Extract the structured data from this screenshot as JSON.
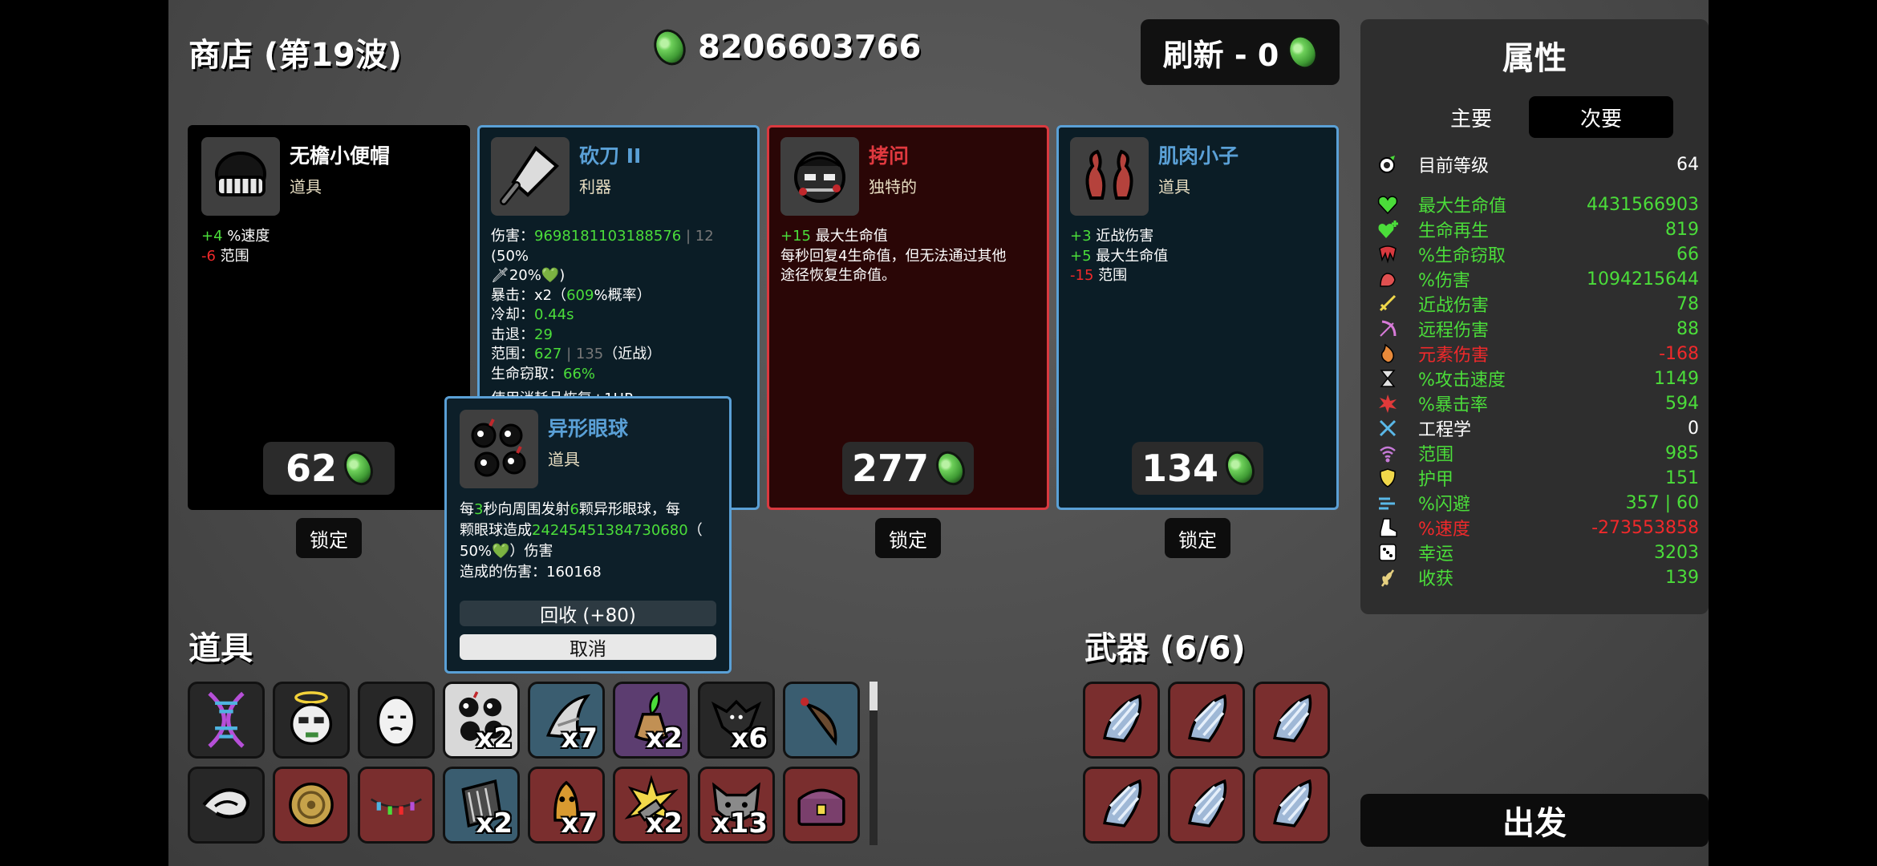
{
  "header": {
    "title": "商店 (第19波)",
    "money": "8206603766",
    "reroll_label": "刷新 - 0"
  },
  "shop": [
    {
      "name": "无檐小便帽",
      "type": "道具",
      "price": "62",
      "lock_label": "锁定",
      "lines": [
        [
          {
            "t": "+4",
            "c": "g"
          },
          {
            "t": " %速度"
          }
        ],
        [
          {
            "t": "-6",
            "c": "r"
          },
          {
            "t": " 范围"
          }
        ]
      ]
    },
    {
      "name": "砍刀 II",
      "type": "利器",
      "use_line": "使用消耗品恢复+1HP",
      "lines": [
        [
          {
            "t": "伤害："
          },
          {
            "t": "9698181103188576",
            "c": "g"
          },
          {
            "t": " | 12",
            "c": "gr"
          },
          {
            "t": " (50%"
          }
        ],
        [
          {
            "t": "🗡20%💚)"
          }
        ],
        [
          {
            "t": "暴击：x2（"
          },
          {
            "t": "609",
            "c": "g"
          },
          {
            "t": "%概率）"
          }
        ],
        [
          {
            "t": "冷却："
          },
          {
            "t": "0.44s",
            "c": "g"
          }
        ],
        [
          {
            "t": "击退："
          },
          {
            "t": "29",
            "c": "g"
          }
        ],
        [
          {
            "t": "范围："
          },
          {
            "t": "627",
            "c": "g"
          },
          {
            "t": " | 135",
            "c": "gr"
          },
          {
            "t": "（近战）"
          }
        ],
        [
          {
            "t": "生命窃取："
          },
          {
            "t": "66%",
            "c": "g"
          }
        ]
      ]
    },
    {
      "name": "拷问",
      "type": "独特的",
      "price": "277",
      "lock_label": "锁定",
      "lines": [
        [
          {
            "t": "+15",
            "c": "g"
          },
          {
            "t": " 最大生命值"
          }
        ],
        [
          {
            "t": "每秒回复4生命值，但无法通过其他"
          }
        ],
        [
          {
            "t": "途径恢复生命值。"
          }
        ]
      ]
    },
    {
      "name": "肌肉小子",
      "type": "道具",
      "price": "134",
      "lock_label": "锁定",
      "lines": [
        [
          {
            "t": "+3",
            "c": "g"
          },
          {
            "t": " 近战伤害"
          }
        ],
        [
          {
            "t": "+5",
            "c": "g"
          },
          {
            "t": " 最大生命值"
          }
        ],
        [
          {
            "t": "-15",
            "c": "r"
          },
          {
            "t": " 范围"
          }
        ]
      ]
    }
  ],
  "popup": {
    "name": "异形眼球",
    "type": "道具",
    "recycle_label": "回收 (+80)",
    "cancel_label": "取消",
    "lines": [
      [
        {
          "t": "每"
        },
        {
          "t": "3",
          "c": "g"
        },
        {
          "t": "秒向周围发射"
        },
        {
          "t": "6",
          "c": "g"
        },
        {
          "t": "颗异形眼球，每"
        }
      ],
      [
        {
          "t": "颗眼球造成"
        },
        {
          "t": "24245451384730680",
          "c": "g"
        },
        {
          "t": "（"
        }
      ],
      [
        {
          "t": "50%💚）伤害"
        }
      ],
      [
        {
          "t": "造成的伤害：160168"
        }
      ]
    ]
  },
  "items_title": "道具",
  "items": [
    {
      "icon": "dna-icon",
      "count": ""
    },
    {
      "icon": "angel-face-icon",
      "count": ""
    },
    {
      "icon": "egg-icon",
      "count": ""
    },
    {
      "icon": "alien-eyes-icon",
      "count": "x2"
    },
    {
      "icon": "claw-icon",
      "count": "x7"
    },
    {
      "icon": "potion-plant-icon",
      "count": "x2"
    },
    {
      "icon": "bat-icon",
      "count": "x6"
    },
    {
      "icon": "leech-icon",
      "count": ""
    },
    {
      "icon": "scarf-icon",
      "count": ""
    },
    {
      "icon": "coin-icon",
      "count": ""
    },
    {
      "icon": "lights-icon",
      "count": ""
    },
    {
      "icon": "bandage-icon",
      "count": "x2"
    },
    {
      "icon": "bell-icon",
      "count": "x7"
    },
    {
      "icon": "explosion-icon",
      "count": "x2"
    },
    {
      "icon": "wolf-icon",
      "count": "x13"
    },
    {
      "icon": "chest-icon",
      "count": ""
    }
  ],
  "weapons_title": "武器 (6/6)",
  "weapons": [
    {
      "icon": "crystal-claw-icon"
    },
    {
      "icon": "crystal-claw-icon"
    },
    {
      "icon": "crystal-claw-icon"
    },
    {
      "icon": "crystal-claw-icon"
    },
    {
      "icon": "crystal-claw-icon"
    },
    {
      "icon": "crystal-claw-icon"
    }
  ],
  "stats": {
    "title": "属性",
    "tab_main": "主要",
    "tab_secondary": "次要",
    "level": {
      "label": "目前等级",
      "value": "64"
    },
    "rows": [
      {
        "label": "最大生命值",
        "value": "4431566903",
        "color": "#4bdd3a",
        "icon": "heart-icon"
      },
      {
        "label": "生命再生",
        "value": "819",
        "color": "#4bdd3a",
        "icon": "heart-plus-icon"
      },
      {
        "label": "%生命窃取",
        "value": "66",
        "color": "#4bdd3a",
        "icon": "fang-icon"
      },
      {
        "label": "%伤害",
        "value": "1094215644",
        "color": "#4bdd3a",
        "icon": "muscle-icon"
      },
      {
        "label": "近战伤害",
        "value": "78",
        "color": "#4bdd3a",
        "icon": "sword-icon"
      },
      {
        "label": "远程伤害",
        "value": "88",
        "color": "#4bdd3a",
        "icon": "bow-icon"
      },
      {
        "label": "元素伤害",
        "value": "-168",
        "color": "#f0292b",
        "icon": "flame-icon"
      },
      {
        "label": "%攻击速度",
        "value": "1149",
        "color": "#4bdd3a",
        "icon": "hourglass-icon"
      },
      {
        "label": "%暴击率",
        "value": "594",
        "color": "#4bdd3a",
        "icon": "crit-icon"
      },
      {
        "label": "工程学",
        "value": "0",
        "color": "#ffffff",
        "icon": "wrench-icon"
      },
      {
        "label": "范围",
        "value": "985",
        "color": "#4bdd3a",
        "icon": "range-icon"
      },
      {
        "label": "护甲",
        "value": "151",
        "color": "#4bdd3a",
        "icon": "shield-icon"
      },
      {
        "label": "%闪避",
        "value": "357 | 60",
        "color": "#4bdd3a",
        "icon": "dodge-icon"
      },
      {
        "label": "%速度",
        "value": "-273553858",
        "color": "#f0292b",
        "icon": "boot-icon"
      },
      {
        "label": "幸运",
        "value": "3203",
        "color": "#4bdd3a",
        "icon": "dice-icon"
      },
      {
        "label": "收获",
        "value": "139",
        "color": "#4bdd3a",
        "icon": "wheat-icon"
      }
    ]
  },
  "go_label": "出发"
}
